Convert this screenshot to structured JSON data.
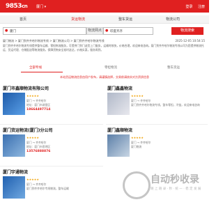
{
  "header": {
    "logo": "9853",
    "logo_suffix": "cn",
    "city": "厦门 ▾",
    "links": [
      "登录",
      "注册"
    ]
  },
  "nav": {
    "items": [
      "首页",
      "货运物流",
      "整车货运",
      "物流公司"
    ],
    "active_index": 1
  },
  "search": {
    "from": "厦门",
    "to": "印度齐齐",
    "from_button": "物流网点",
    "to_button": "物流搜索"
  },
  "breadcrumb": "厦门物流 > 厦门到齐齐哈尔物流专线 > 厦门物流公司 > 厦门到齐齐哈尔物流专线",
  "date": "2025-12-05 10:54:15",
  "description": "厦门到齐齐哈尔物流专线提供整车运输、零担物流服务，可提供门到门送货上门服务，运输时效快，价格合理，欢迎来电咨询。厦门到齐齐哈尔物流专线公司为您提供物流托运、货运代理、仓储配送等物流服务，保障货物安全准时送达，价格实惠，服务周到。",
  "subtabs": {
    "items": [
      "全部专线",
      "零担物流",
      "整车货运"
    ],
    "active_index": 0
  },
  "notice": "本站货运物流信息由用户发布，请谨慎选择，交易前请核实对方资质信息",
  "cards": [
    {
      "title": "厦门市鑫顺物流有限公司",
      "rating": "★★★★★",
      "lines": [
        "厦门 → 齐齐哈尔",
        "地址：厦门市湖里区"
      ],
      "tel": "18664497714"
    },
    {
      "title": "厦门鑫鑫物流",
      "rating": "★★★★★",
      "lines": [
        "厦门 → 齐齐哈尔",
        "厦门到齐齐哈尔物流专线，整车零担，冷链，欢迎来电咨询"
      ],
      "tel": ""
    },
    {
      "title": "厦门货运物流(厦门)分公司",
      "rating": "★★★★★",
      "lines": [
        "厦门 → 齐齐哈尔",
        "地址：厦门市思明区"
      ],
      "tel": "13576888876"
    },
    {
      "title": "厦门鑫顺物流",
      "rating": "★★★★★",
      "lines": [
        "厦门 → 齐齐哈尔",
        "厦门物流"
      ],
      "tel": ""
    },
    {
      "title": "厦门宇通物流",
      "rating": "★★★★★",
      "lines": [
        "厦门 → 齐齐哈尔",
        "厦门到齐齐哈尔专线物流，整车运输"
      ],
      "tel": ""
    }
  ],
  "watermark": {
    "text": "自动秒收录",
    "sub": "随 上 随 录 · 秒 · 统 一 · 稳 定 发 展"
  }
}
